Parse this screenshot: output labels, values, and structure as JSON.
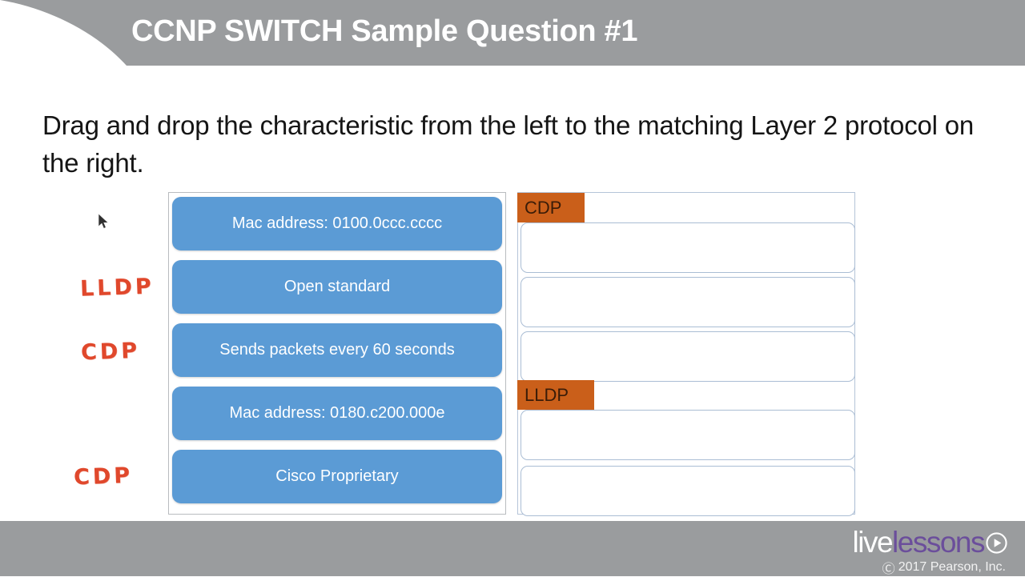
{
  "header": {
    "title": "CCNP SWITCH Sample Question #1",
    "band_color": "#9a9c9e"
  },
  "prompt": {
    "text": "Drag and drop the characteristic from the left to the matching Layer 2 protocol on the right."
  },
  "source_panel": {
    "items": [
      {
        "label": "Mac address: 0100.0ccc.cccc"
      },
      {
        "label": "Open standard"
      },
      {
        "label": "Sends packets every 60 seconds"
      },
      {
        "label": "Mac address: 0180.c200.000e"
      },
      {
        "label": "Cisco Proprietary"
      }
    ],
    "item_color": "#5b9bd5"
  },
  "target_panel": {
    "groups": [
      {
        "label": "CDP"
      },
      {
        "label": "LLDP"
      }
    ],
    "tab_color": "#ca5f1a",
    "slots": [
      {
        "content": ""
      },
      {
        "content": ""
      },
      {
        "content": ""
      },
      {
        "content": ""
      },
      {
        "content": ""
      }
    ]
  },
  "annotations": {
    "ink_color": "#e0482c",
    "notes": [
      {
        "text": "LLDP"
      },
      {
        "text": "CDP"
      },
      {
        "text": "CDP"
      }
    ]
  },
  "footer": {
    "brand_live": "live",
    "brand_lessons": "lessons",
    "copyright_symbol": "Ⓒ",
    "copyright": "2017 Pearson, Inc.",
    "band_color": "#9a9c9e",
    "accent_color": "#6b4e9b"
  }
}
